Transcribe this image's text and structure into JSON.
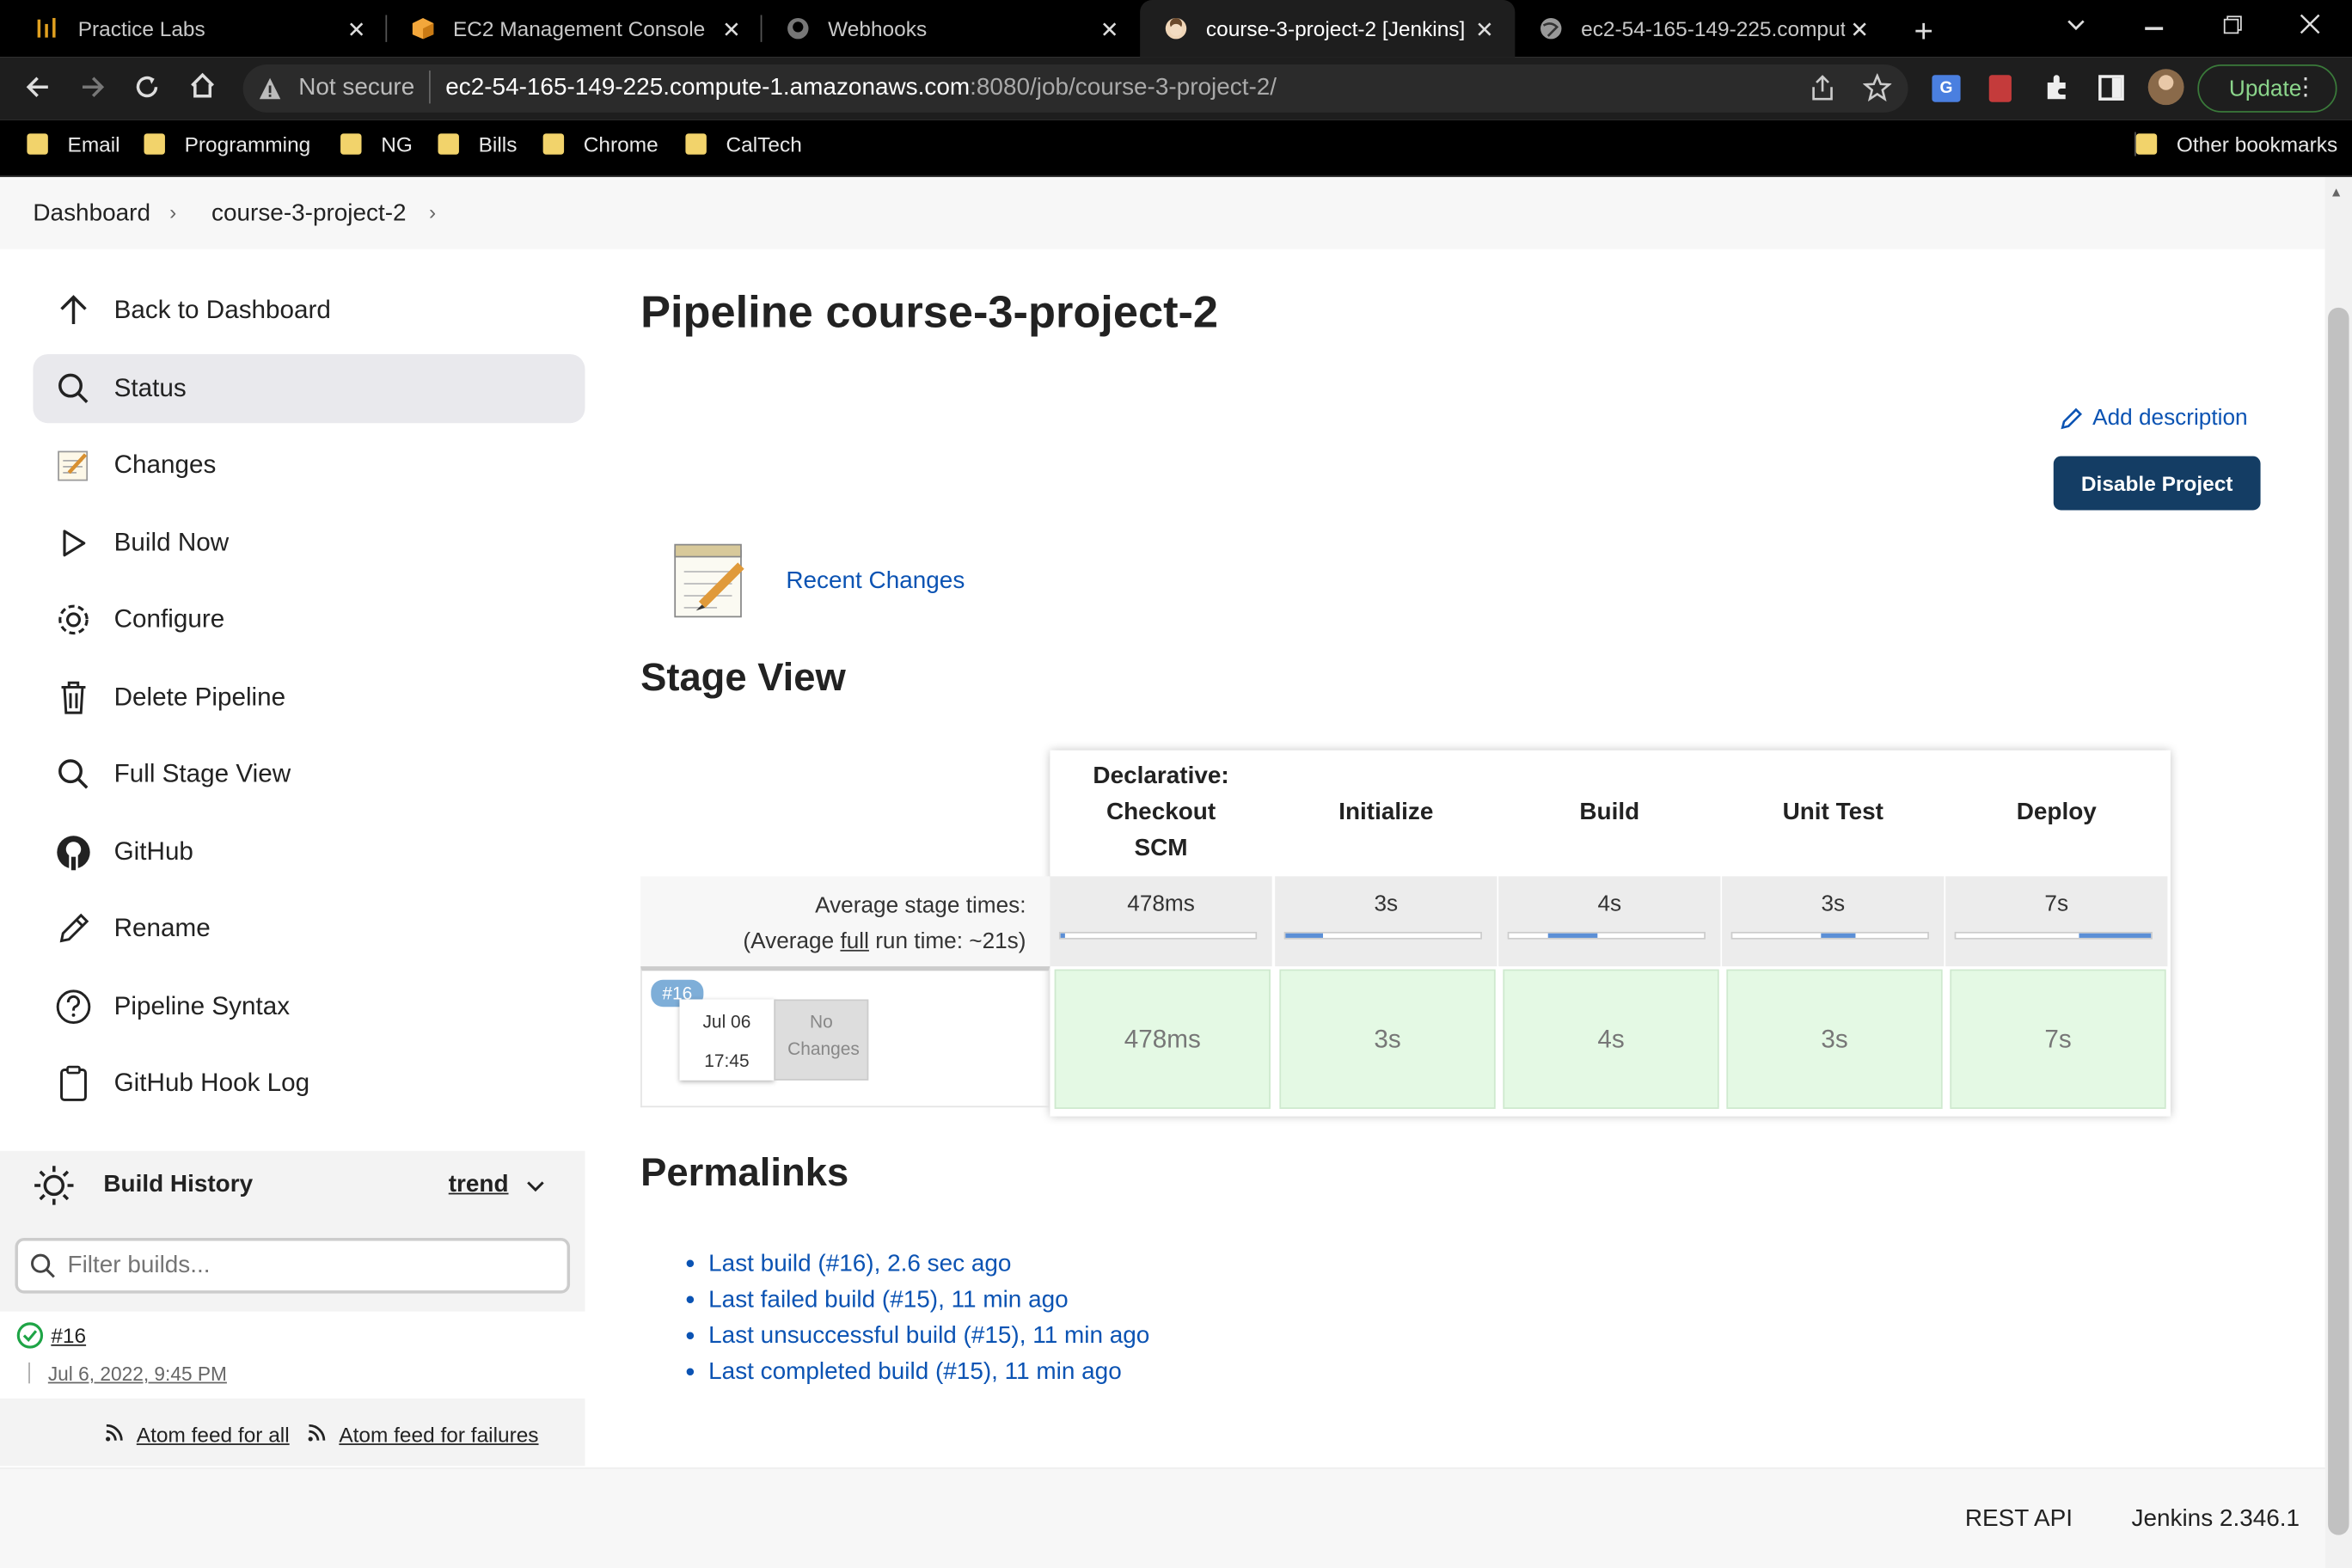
{
  "browser": {
    "tabs": [
      {
        "title": "Practice Labs",
        "icon": "practice-labs-icon",
        "active": false
      },
      {
        "title": "EC2 Management Console",
        "icon": "aws-box-icon",
        "active": false
      },
      {
        "title": "Webhooks",
        "icon": "github-icon",
        "active": false
      },
      {
        "title": "course-3-project-2 [Jenkins]",
        "icon": "jenkins-icon",
        "active": true
      },
      {
        "title": "ec2-54-165-149-225.comput",
        "icon": "globe-icon",
        "active": false
      }
    ],
    "security_label": "Not secure",
    "url_host": "ec2-54-165-149-225.compute-1.amazonaws.com",
    "url_path": ":8080/job/course-3-project-2/",
    "update_label": "Update",
    "bookmarks": [
      "Email",
      "Programming",
      "NG",
      "Bills",
      "Chrome",
      "CalTech"
    ],
    "other_bookmarks": "Other bookmarks"
  },
  "breadcrumb": {
    "dashboard": "Dashboard",
    "project": "course-3-project-2"
  },
  "sidebar": {
    "items": [
      {
        "label": "Back to Dashboard",
        "icon": "arrow-up-icon"
      },
      {
        "label": "Status",
        "icon": "search-icon"
      },
      {
        "label": "Changes",
        "icon": "notepad-icon"
      },
      {
        "label": "Build Now",
        "icon": "play-icon"
      },
      {
        "label": "Configure",
        "icon": "gear-icon"
      },
      {
        "label": "Delete Pipeline",
        "icon": "trash-icon"
      },
      {
        "label": "Full Stage View",
        "icon": "search-icon"
      },
      {
        "label": "GitHub",
        "icon": "github-icon"
      },
      {
        "label": "Rename",
        "icon": "pencil-icon"
      },
      {
        "label": "Pipeline Syntax",
        "icon": "help-icon"
      },
      {
        "label": "GitHub Hook Log",
        "icon": "clipboard-icon"
      }
    ],
    "build_history": {
      "title": "Build History",
      "trend": "trend",
      "filter_placeholder": "Filter builds...",
      "builds": [
        {
          "number": "#16",
          "date": "Jul 6, 2022, 9:45 PM",
          "status": "success"
        }
      ],
      "atom_all": "Atom feed for all",
      "atom_failures": "Atom feed for failures"
    }
  },
  "main": {
    "title": "Pipeline course-3-project-2",
    "add_description": "Add description",
    "disable_project": "Disable Project",
    "recent_changes": "Recent Changes",
    "stage_view_title": "Stage View",
    "stages": [
      {
        "name": "Declarative: Checkout SCM",
        "avg": "478ms",
        "avg_fill": [
          0.0,
          0.02
        ],
        "build16": "478ms"
      },
      {
        "name": "Initialize",
        "avg": "3s",
        "avg_fill": [
          0.0,
          0.19
        ],
        "build16": "3s"
      },
      {
        "name": "Build",
        "avg": "4s",
        "avg_fill": [
          0.2,
          0.45
        ],
        "build16": "4s"
      },
      {
        "name": "Unit Test",
        "avg": "3s",
        "avg_fill": [
          0.45,
          0.63
        ],
        "build16": "3s"
      },
      {
        "name": "Deploy",
        "avg": "7s",
        "avg_fill": [
          0.63,
          1.0
        ],
        "build16": "7s"
      }
    ],
    "avg_label": "Average stage times:",
    "avg_run_pre": "(Average ",
    "avg_run_full": "full",
    "avg_run_post": " run time: ~21s)",
    "build_row": {
      "badge": "#16",
      "date": "Jul 06",
      "time": "17:45",
      "changes": "No Changes"
    },
    "permalinks_title": "Permalinks",
    "permalinks": [
      "Last build (#16), 2.6 sec ago",
      "Last failed build (#15), 11 min ago",
      "Last unsuccessful build (#15), 11 min ago",
      "Last completed build (#15), 11 min ago"
    ]
  },
  "footer": {
    "rest_api": "REST API",
    "version": "Jenkins 2.346.1"
  },
  "colors": {
    "accent": "#0b53b3",
    "primary_button": "#143d64",
    "success_cell": "#e4f9e4",
    "bar_fill": "#5b8fd6"
  }
}
